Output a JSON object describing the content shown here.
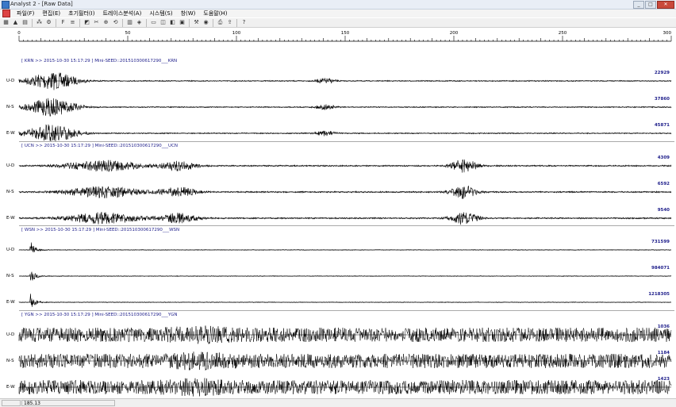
{
  "window": {
    "title": "Analyst 2 - [Raw Data]",
    "buttons": [
      "_",
      "□",
      "✕"
    ]
  },
  "menu": [
    {
      "label": "파일(F)"
    },
    {
      "label": "편집(E)"
    },
    {
      "label": "초기필터(I)"
    },
    {
      "label": "트레이스분석(A)"
    },
    {
      "label": "시스템(S)"
    },
    {
      "label": "창(W)"
    },
    {
      "label": "도움말(H)"
    }
  ],
  "toolbar": [
    "open-icon",
    "up-icon",
    "save-icon",
    "sep",
    "pick-icon",
    "filter-icon",
    "sep",
    "f-icon",
    "list-icon",
    "sep",
    "mark-icon",
    "cut-icon",
    "zoom-icon",
    "rotate-icon",
    "sep",
    "grid-icon",
    "graph-icon",
    "sep",
    "window-icon",
    "tile-icon",
    "split-icon",
    "layout-icon",
    "sep",
    "settings-icon",
    "magnify-icon",
    "sep",
    "print-icon",
    "export-icon",
    "sep",
    "help-icon"
  ],
  "ruler": {
    "ticks": [
      "0",
      "50",
      "100",
      "150",
      "200",
      "250",
      "300"
    ]
  },
  "stations": [
    {
      "header": "[ KRN >> 2015-10-30 15:17:29 ] Mini-SEED::201510300617290___KRN",
      "channels": [
        {
          "comp": "U-D",
          "amp": "22929"
        },
        {
          "comp": "N-S",
          "amp": "37860"
        },
        {
          "comp": "E-W",
          "amp": "45871"
        }
      ]
    },
    {
      "header": "[ UCN >> 2015-10-30 15:17:29 ] Mini-SEED::201510300617290___UCN",
      "channels": [
        {
          "comp": "U-D",
          "amp": "4309"
        },
        {
          "comp": "N-S",
          "amp": "6592"
        },
        {
          "comp": "E-W",
          "amp": "9540"
        }
      ]
    },
    {
      "header": "[ WSN >> 2015-10-30 15:17:29 ] Mini-SEED::201510300617290___WSN",
      "channels": [
        {
          "comp": "U-D",
          "amp": "731599"
        },
        {
          "comp": "N-S",
          "amp": "984071"
        },
        {
          "comp": "E-W",
          "amp": "1218305"
        }
      ]
    },
    {
      "header": "[ YGN >> 2015-10-30 15:17:29 ] Mini-SEED::201510300617290___YGN",
      "channels": [
        {
          "comp": "U-D",
          "amp": "1036"
        },
        {
          "comp": "N-S",
          "amp": "1184"
        },
        {
          "comp": "E-W",
          "amp": "1423"
        }
      ]
    }
  ],
  "statusbar": {
    "value": "185.13"
  }
}
